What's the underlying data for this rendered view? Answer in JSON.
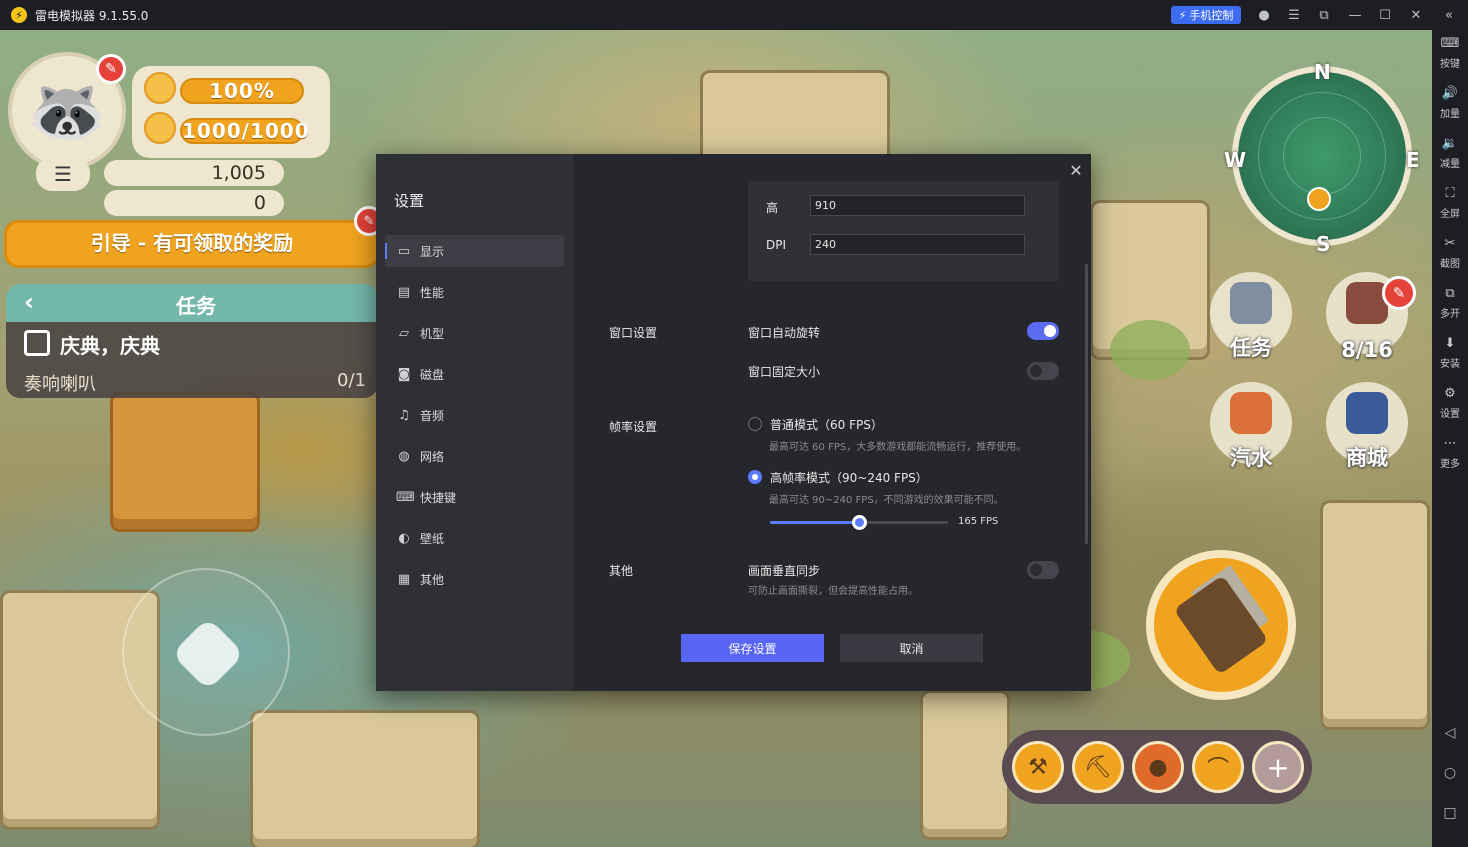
{
  "titlebar": {
    "app_title": "雷电模拟器 9.1.55.0",
    "phone_control": "手机控制",
    "icons": [
      "user-icon",
      "menu-icon",
      "restore-icon",
      "minimize-icon",
      "maximize-icon",
      "close-icon",
      "collapse-icon"
    ]
  },
  "sidebar": {
    "items": [
      {
        "icon": "keyboard-icon",
        "label": "按键"
      },
      {
        "icon": "volume-up-icon",
        "label": "加量"
      },
      {
        "icon": "volume-down-icon",
        "label": "减量"
      },
      {
        "icon": "fullscreen-icon",
        "label": "全屏"
      },
      {
        "icon": "scissors-icon",
        "label": "截图"
      },
      {
        "icon": "multi-window-icon",
        "label": "多开"
      },
      {
        "icon": "install-icon",
        "label": "安装"
      },
      {
        "icon": "settings-icon",
        "label": "设置"
      },
      {
        "icon": "more-icon",
        "label": "更多"
      }
    ],
    "nav": [
      "back-icon",
      "home-icon",
      "recents-icon"
    ]
  },
  "game": {
    "hud": {
      "level_pct": "100%",
      "energy": "1000/1000",
      "coins": "1,005",
      "gems": "0",
      "guide_banner": "引导 - 有可领取的奖励",
      "task_header": "任务",
      "task_name": "庆典，庆典",
      "task_sub": "奏响喇叭",
      "task_count": "0/1"
    },
    "compass": {
      "n": "N",
      "s": "S",
      "e": "E",
      "w": "W"
    },
    "buttons": {
      "tasks": "任务",
      "bag": "8/16",
      "soda": "汽水",
      "shop": "商城"
    }
  },
  "settings": {
    "title": "设置",
    "nav": [
      {
        "icon": "monitor-icon",
        "label": "显示"
      },
      {
        "icon": "performance-icon",
        "label": "性能"
      },
      {
        "icon": "device-model-icon",
        "label": "机型"
      },
      {
        "icon": "disk-icon",
        "label": "磁盘"
      },
      {
        "icon": "audio-icon",
        "label": "音频"
      },
      {
        "icon": "network-icon",
        "label": "网络"
      },
      {
        "icon": "shortcut-icon",
        "label": "快捷键"
      },
      {
        "icon": "wallpaper-icon",
        "label": "壁纸"
      },
      {
        "icon": "other-icon",
        "label": "其他"
      }
    ],
    "active_nav": "显示",
    "resolution": {
      "height_label": "高",
      "height_value": "910",
      "dpi_label": "DPI",
      "dpi_value": "240"
    },
    "window": {
      "section": "窗口设置",
      "auto_rotate": "窗口自动旋转",
      "auto_rotate_on": true,
      "fixed_size": "窗口固定大小",
      "fixed_size_on": false
    },
    "framerate": {
      "section": "帧率设置",
      "normal": "普通模式（60 FPS）",
      "normal_desc": "最高可达 60 FPS，大多数游戏都能流畅运行，推荐使用。",
      "high": "高帧率模式（90~240 FPS）",
      "high_desc": "最高可达 90~240 FPS，不同游戏的效果可能不同。",
      "selected": "high",
      "fps_min": 90,
      "fps_max": 240,
      "fps_value": 165,
      "fps_label": "165 FPS"
    },
    "other": {
      "section": "其他",
      "vsync": "画面垂直同步",
      "vsync_desc": "可防止画面撕裂，但会提高性能占用。",
      "vsync_on": false
    },
    "save": "保存设置",
    "cancel": "取消"
  },
  "colors": {
    "accent": "#5b6cf0",
    "panel": "#26272c",
    "nav_panel": "#2f3036",
    "hud_orange": "#f0a31e"
  }
}
